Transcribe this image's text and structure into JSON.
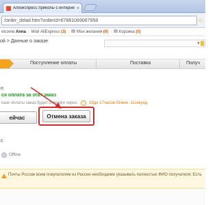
{
  "browser": {
    "tab_title": "Алиэкспресс приколы с интернетом ...",
    "tab_close": "×",
    "url": "/order_detail.htm?orderId=67881089067958"
  },
  "topnav": {
    "welcome_prefix": "elcome",
    "user_name": "Anna",
    "my_aliexpress": "Мой AliExpress",
    "my_aliexpress_count": "(3)",
    "favorites": "Мои желания",
    "favorites_count": "(0)",
    "cart": "Корзина",
    "cart_count": "(0)"
  },
  "breadcrumb": "ой > Данные о заказе",
  "progress": {
    "steps": [
      "Поступление оплаты",
      "Поставка",
      "Получ"
    ]
  },
  "order": {
    "left_label": "о",
    "status_text": "ся оплата за этот заказ",
    "cancel_info": "казе оплаты заказ будет отменён через:",
    "timer": "19дн 17часов 31мин. 11секунд"
  },
  "buttons": {
    "pay_now": "ейчас",
    "cancel_order": "Отмена заказа"
  },
  "seller": {
    "left_label": "с",
    "online_status": "Offline"
  },
  "notice": {
    "text": "Почты России всем покупателям из России необходимо указывать полностью ФИО получателя. Есть"
  },
  "colors": {
    "accent": "#f7a21b",
    "highlight": "#d42a2a",
    "status_green": "#1a9a1a",
    "timer_orange": "#e07b00"
  }
}
